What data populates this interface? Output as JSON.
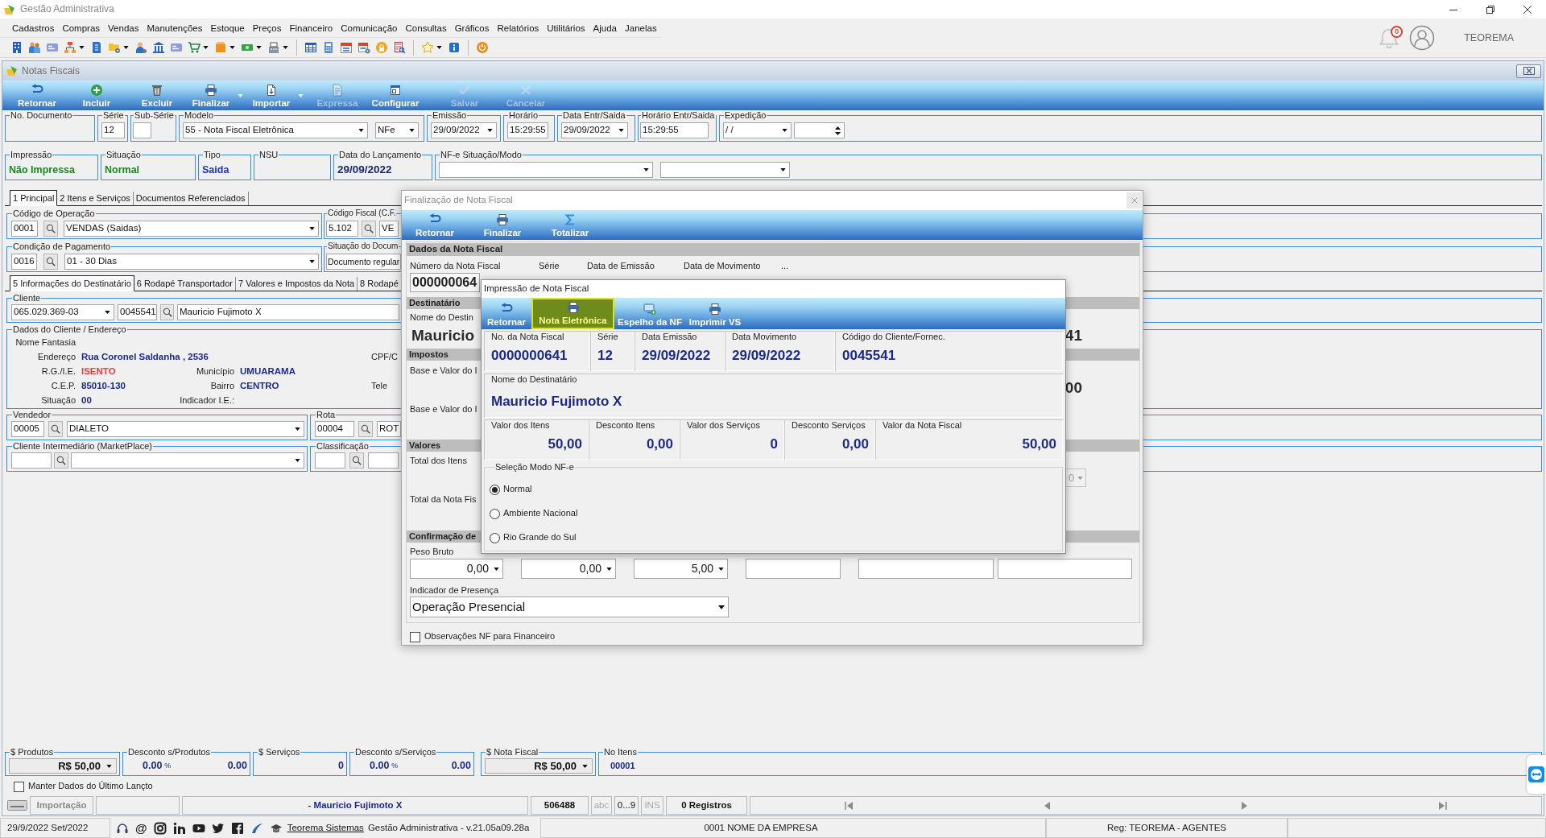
{
  "app": {
    "title": "Gestão Administrativa",
    "notifications": "0",
    "user": "TEOREMA"
  },
  "menu": [
    "Cadastros",
    "Compras",
    "Vendas",
    "Manutenções",
    "Estoque",
    "Preços",
    "Financeiro",
    "Comunicação",
    "Consultas",
    "Gráficos",
    "Relatórios",
    "Utilitários",
    "Ajuda",
    "Janelas"
  ],
  "form": {
    "title": "Notas Fiscais",
    "actions": [
      {
        "label": "Retornar",
        "disabled": false,
        "dropdown": false
      },
      {
        "label": "Incluir",
        "disabled": false,
        "dropdown": false
      },
      {
        "label": "Excluir",
        "disabled": false,
        "dropdown": false
      },
      {
        "label": "Finalizar",
        "disabled": false,
        "dropdown": true
      },
      {
        "label": "Importar",
        "disabled": false,
        "dropdown": true
      },
      {
        "label": "Expressa",
        "disabled": true,
        "dropdown": false
      },
      {
        "label": "Configurar",
        "disabled": false,
        "dropdown": false
      },
      {
        "label": "Salvar",
        "disabled": true,
        "dropdown": false
      },
      {
        "label": "Cancelar",
        "disabled": true,
        "dropdown": false
      }
    ],
    "header_row_1": [
      {
        "label": "No. Documento"
      },
      {
        "label": "Série",
        "fields": [
          {
            "kind": "text",
            "value": "12"
          }
        ]
      },
      {
        "label": "Sub-Série",
        "fields": [
          {
            "kind": "text"
          }
        ]
      },
      {
        "label": "Modelo",
        "fields": [
          {
            "kind": "combo",
            "value": "55 - Nota Fiscal Eletrônica"
          },
          {
            "kind": "combo",
            "value": "NFe"
          }
        ]
      },
      {
        "label": "Emissão",
        "fields": [
          {
            "kind": "combo",
            "value": "29/09/2022"
          }
        ]
      },
      {
        "label": "Horário",
        "fields": [
          {
            "kind": "text",
            "value": "15:29:55"
          }
        ]
      },
      {
        "label": "Data Entr/Saida",
        "fields": [
          {
            "kind": "combo",
            "value": "29/09/2022"
          }
        ]
      },
      {
        "label": "Horário Entr/Saida",
        "fields": [
          {
            "kind": "text",
            "value": "15:29:55"
          }
        ]
      },
      {
        "label": "Expedição",
        "fields": [
          {
            "kind": "combo",
            "value": "/ /"
          },
          {
            "kind": "spin"
          }
        ]
      }
    ],
    "header_row_2": [
      {
        "label": "Impressão",
        "fields": [
          {
            "kind": "display",
            "value": "Não Impressa",
            "color": "#1b8a1b"
          }
        ]
      },
      {
        "label": "Situação",
        "fields": [
          {
            "kind": "display",
            "value": "Normal",
            "color": "#1b8a1b"
          }
        ]
      },
      {
        "label": "Tipo",
        "fields": [
          {
            "kind": "display",
            "value": "Saida",
            "color": "#1f2fe0"
          }
        ]
      },
      {
        "label": "NSU"
      },
      {
        "label": "Data do Lançamento",
        "fields": [
          {
            "kind": "display",
            "value": "29/09/2022",
            "color": "#1c2870"
          }
        ]
      },
      {
        "label": "NF-e Situação/Modo",
        "fields": [
          {
            "kind": "combo"
          },
          {
            "kind": "combo"
          }
        ]
      }
    ],
    "tabs": [
      {
        "label": "1 Principal",
        "selected": true
      },
      {
        "label": "2 Itens e Serviços",
        "selected": false
      },
      {
        "label": "Documentos Referenciados",
        "selected": false
      }
    ],
    "operation_rows": [
      [
        {
          "label": "Código de Operação",
          "fields": [
            {
              "kind": "text",
              "value": "0001"
            },
            {
              "kind": "search"
            },
            {
              "kind": "combo",
              "value": "VENDAS (Saidas)"
            }
          ]
        },
        {
          "label": "Código Fiscal (C.F.",
          "fields": [
            {
              "kind": "text",
              "value": "5.102"
            },
            {
              "kind": "search"
            },
            {
              "kind": "text",
              "value": "VE"
            }
          ]
        }
      ],
      [
        {
          "label": "Condição de Pagamento",
          "fields": [
            {
              "kind": "text",
              "value": "0016"
            },
            {
              "kind": "search"
            },
            {
              "kind": "combo",
              "value": "01 - 30 Dias"
            }
          ]
        },
        {
          "label": "Situação do Docum",
          "fields": [
            {
              "kind": "text",
              "value": "Documento regular"
            }
          ]
        }
      ]
    ],
    "detail_tabs": [
      {
        "label": "5 Informações do Destinatário",
        "selected": true
      },
      {
        "label": "6 Rodapé Transportador",
        "selected": false
      },
      {
        "label": "7 Valores e Impostos da Nota",
        "selected": false
      },
      {
        "label": "8 Rodapé",
        "selected": false
      }
    ],
    "client": {
      "label": "Cliente",
      "fields": [
        {
          "kind": "combo",
          "value": "065.029.369-03"
        },
        {
          "kind": "text",
          "value": "0045541"
        },
        {
          "kind": "search"
        },
        {
          "kind": "text",
          "value": "Mauricio Fujimoto X"
        }
      ]
    },
    "address": {
      "label": "Dados do Cliente / Endereço",
      "rows": [
        {
          "left": {
            "label": "Nome Fantasia"
          }
        },
        {
          "left": {
            "label": "Endereço",
            "value": "Rua Coronel Saldanha , 2536",
            "color": "#1c2a9a"
          },
          "right": {
            "label": "CPF/C"
          }
        },
        {
          "left": {
            "label": "R.G./I.E.",
            "value": "ISENTO",
            "color": "#f03a3a"
          },
          "center": {
            "label": "Município",
            "value": "UMUARAMA",
            "color": "#1c2a9a"
          }
        },
        {
          "left": {
            "label": "C.E.P.",
            "value": "85010-130",
            "color": "#1c2a9a"
          },
          "center": {
            "label": "Bairro",
            "value": "CENTRO",
            "color": "#1c2a9a"
          },
          "right": {
            "label": "Tele"
          }
        },
        {
          "left": {
            "label": "Situação",
            "value": "00",
            "color": "#1c2a9a"
          },
          "center": {
            "label": "Indicador I.E.:"
          }
        }
      ]
    },
    "bottom_rows": [
      [
        {
          "label": "Vendedor",
          "fields": [
            {
              "kind": "text",
              "value": "00005"
            },
            {
              "kind": "search"
            },
            {
              "kind": "combo",
              "value": "DIALETO"
            }
          ]
        },
        {
          "label": "Rota",
          "fields": [
            {
              "kind": "text",
              "value": "00004"
            },
            {
              "kind": "search"
            },
            {
              "kind": "text",
              "value": "ROT"
            }
          ]
        }
      ],
      [
        {
          "label": "Cliente Intermediário (MarketPlace)",
          "fields": [
            {
              "kind": "text"
            },
            {
              "kind": "search"
            },
            {
              "kind": "combo"
            }
          ]
        },
        {
          "label": "Classificação",
          "fields": [
            {
              "kind": "text"
            },
            {
              "kind": "search"
            },
            {
              "kind": "text"
            }
          ]
        }
      ]
    ],
    "totals": [
      {
        "label": "$ Produtos",
        "fields": [
          {
            "kind": "combo",
            "value": "R$ 50,00"
          }
        ]
      },
      {
        "label": "Desconto s/Produtos",
        "fields": [
          {
            "kind": "number",
            "value": "0.00"
          },
          {
            "kind": "unit",
            "value": "%"
          },
          {
            "kind": "number",
            "value": "0.00"
          }
        ]
      },
      {
        "label": "$ Serviços",
        "fields": [
          {
            "kind": "number",
            "value": "0"
          }
        ]
      },
      {
        "label": "Desconto s/Serviços",
        "fields": [
          {
            "kind": "number",
            "value": "0.00"
          },
          {
            "kind": "unit",
            "value": "%"
          },
          {
            "kind": "number",
            "value": "0.00"
          }
        ]
      },
      {
        "label": "$ Nota Fiscal",
        "fields": [
          {
            "kind": "combo",
            "value": "R$ 50,00"
          }
        ]
      },
      {
        "label": "No Itens",
        "fields": [
          {
            "kind": "number",
            "value": "00001"
          }
        ]
      }
    ],
    "keep_data": {
      "label": "Manter Dados do Último Lançto",
      "checked": false
    },
    "status_bar": [
      {
        "kind": "label",
        "text": "Importação"
      },
      {
        "kind": "name",
        "text": "- Mauricio Fujimoto X"
      },
      {
        "kind": "number",
        "text": "506488"
      },
      {
        "kind": "indicator",
        "text": "abc",
        "on": false
      },
      {
        "kind": "indicator",
        "text": "0...9",
        "on": true
      },
      {
        "kind": "indicator",
        "text": "INS",
        "on": false
      },
      {
        "kind": "number",
        "text": "0 Registros"
      }
    ]
  },
  "footer": {
    "date": "29/9/2022 Set/2022",
    "at_sign": "@",
    "link": "Teorema Sistemas",
    "version": "Gestão Administrativa - v.21.05a09.28a",
    "company": "0001 NOME DA EMPRESA",
    "registration": "Reg: TEOREMA - AGENTES"
  },
  "finalization": {
    "title": "Finalização de Nota Fiscal",
    "actions": [
      "Retornar",
      "Finalizar",
      "Totalizar"
    ],
    "invoice_header": "Dados da Nota Fiscal",
    "invoice_columns": [
      "Número da Nota Fiscal",
      "Série",
      "Data de Emissão",
      "Data de Movimento",
      "..."
    ],
    "invoice_number": "000000064",
    "recipient_header": "Destinatário",
    "recipient_label": "Nome do Destin",
    "recipient_name": "Mauricio",
    "recipient_code": "41",
    "taxes_header": "Impostos",
    "tax_labels": [
      "Base e Valor do I",
      "Base e Valor do I"
    ],
    "tax_value": "00",
    "values_header": "Valores",
    "value_labels": [
      "Total dos Itens",
      "Total da Nota Fis"
    ],
    "value_combo": {
      "value": "0",
      "disabled": true
    },
    "confirmation_header": "Confirmação de",
    "weight_label": "Peso Bruto",
    "confirmation_fields": [
      {
        "kind": "combo",
        "value": "0,00"
      },
      {
        "kind": "combo",
        "value": "0,00"
      },
      {
        "kind": "combo",
        "value": "5,00"
      },
      {
        "kind": "text"
      },
      {
        "kind": "text"
      },
      {
        "kind": "text"
      }
    ],
    "presence_label": "Indicador de Presença",
    "presence_value": "Operação Presencial",
    "notes": {
      "label": "Observações NF para Financeiro",
      "checked": false
    }
  },
  "print_dialog": {
    "title": "Impressão de Nota Fiscal",
    "actions": [
      {
        "label": "Retornar",
        "highlighted": false
      },
      {
        "label": "Nota Eletrônica",
        "highlighted": true
      },
      {
        "label": "Espelho da NF",
        "highlighted": false
      },
      {
        "label": "Imprimir VS",
        "highlighted": false
      }
    ],
    "summary": [
      {
        "label": "No. da Nota Fiscal",
        "value": "0000000641"
      },
      {
        "label": "Série",
        "value": "12"
      },
      {
        "label": "Data Emissão",
        "value": "29/09/2022"
      },
      {
        "label": "Data Movimento",
        "value": "29/09/2022"
      },
      {
        "label": "Código do Cliente/Fornec.",
        "value": "0045541"
      }
    ],
    "recipient": {
      "label": "Nome do Destinatário",
      "value": "Mauricio Fujimoto X"
    },
    "amounts": [
      {
        "label": "Valor dos Itens",
        "value": "50,00"
      },
      {
        "label": "Desconto Itens",
        "value": "0,00"
      },
      {
        "label": "Valor dos Serviços",
        "value": "0"
      },
      {
        "label": "Desconto Serviços",
        "value": "0,00"
      },
      {
        "label": "Valor da Nota Fiscal",
        "value": "50,00"
      }
    ],
    "mode": {
      "label": "Seleção Modo NF-e",
      "options": [
        {
          "label": "Normal",
          "selected": true
        },
        {
          "label": "Ambiente Nacional",
          "selected": false
        },
        {
          "label": "Rio Grande do Sul",
          "selected": false
        }
      ]
    }
  }
}
